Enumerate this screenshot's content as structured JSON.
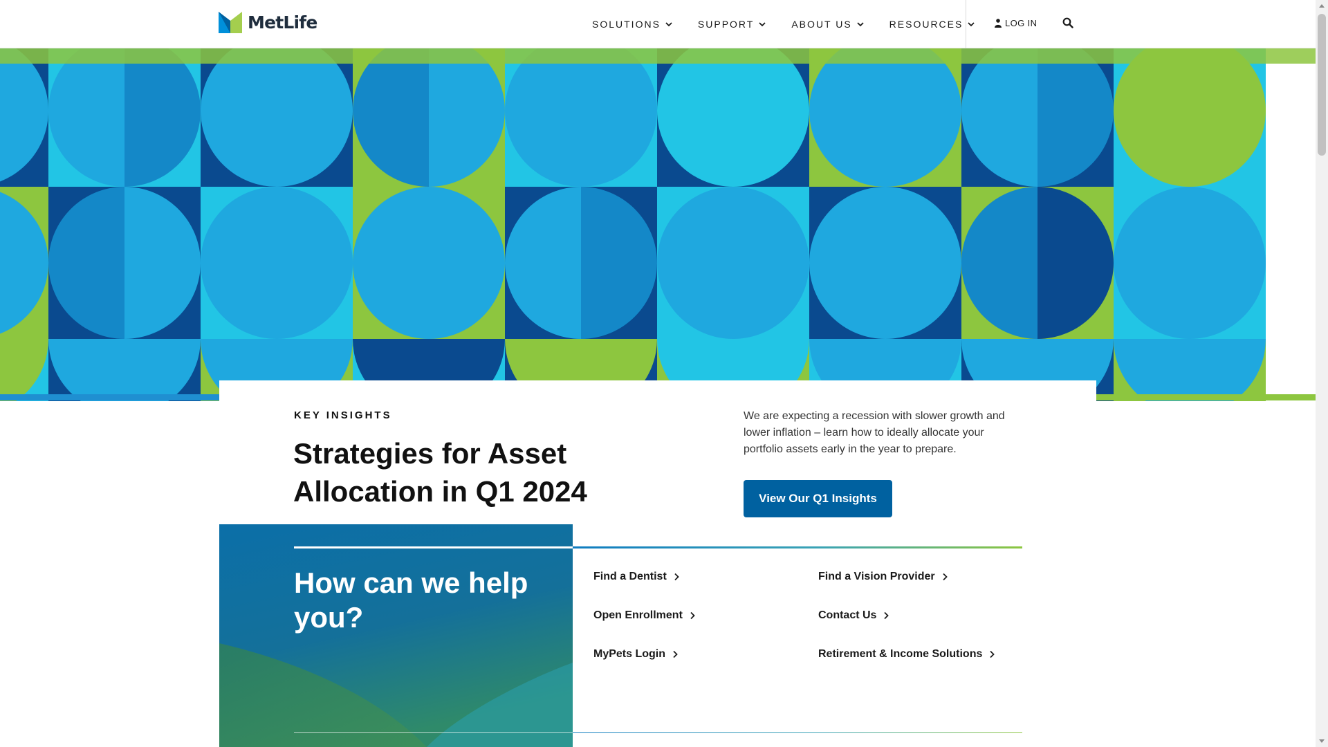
{
  "header": {
    "logo_text": "MetLife",
    "nav": [
      {
        "label": "SOLUTIONS"
      },
      {
        "label": "SUPPORT"
      },
      {
        "label": "ABOUT US"
      },
      {
        "label": "RESOURCES"
      }
    ],
    "login_label": "LOG IN",
    "icons": {
      "login": "user-icon",
      "search": "search-icon",
      "dropdown": "chevron-down-icon"
    }
  },
  "insight": {
    "eyebrow": "KEY INSIGHTS",
    "headline": "Strategies for Asset Allocation in Q1 2024",
    "summary": "We are expecting a recession with slower growth and lower inflation – learn  how to ideally allocate your portfolio assets early in the year to prepare.",
    "cta_label": "View Our Q1 Insights"
  },
  "help": {
    "title": "How can we help you?",
    "links": [
      {
        "label": "Find a Dentist"
      },
      {
        "label": "Find a Vision Provider"
      },
      {
        "label": "Open Enrollment"
      },
      {
        "label": "Contact Us"
      },
      {
        "label": "MyPets Login"
      },
      {
        "label": "Retirement & Income Solutions"
      }
    ]
  },
  "colors": {
    "brand_blue": "#0061a0",
    "brand_green": "#8dc63f",
    "hero_light_blue": "#1fa8df",
    "hero_dark_blue": "#0a4a8f",
    "hero_cyan": "#22c5e5"
  }
}
